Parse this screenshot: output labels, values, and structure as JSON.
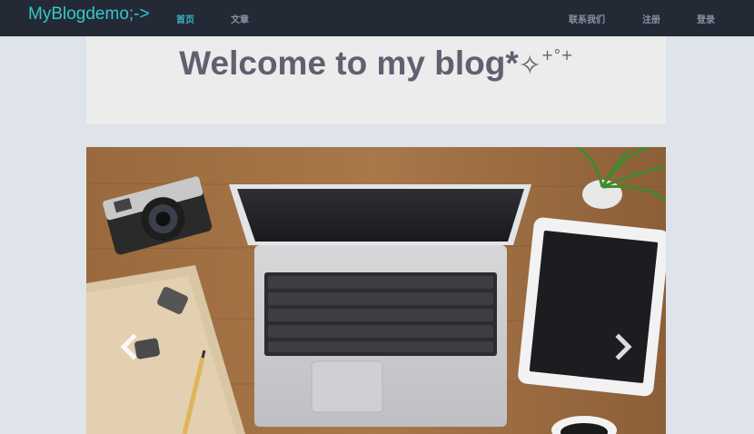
{
  "navbar": {
    "brand": "MyBlogdemo;->",
    "links_left": [
      {
        "label": "首页",
        "active": true
      },
      {
        "label": "文章",
        "active": false
      }
    ],
    "links_right": [
      {
        "label": "联系我们"
      },
      {
        "label": "注册"
      },
      {
        "label": "登录"
      }
    ]
  },
  "hero": {
    "title": "Welcome to my blog*",
    "sparkle": "✧",
    "sparkle_tail": "+°+"
  },
  "carousel": {
    "image_description_icon": "laptop-desk-photo",
    "prev_icon": "chevron-left-icon",
    "next_icon": "chevron-right-icon"
  },
  "colors": {
    "navbar_bg": "#232a35",
    "brand": "#39c5cc",
    "active_link": "#3ab4c6",
    "link": "#8793a3",
    "page_bg": "#dfe3ea",
    "hero_bg": "#ececec",
    "hero_text": "#5f6170"
  }
}
